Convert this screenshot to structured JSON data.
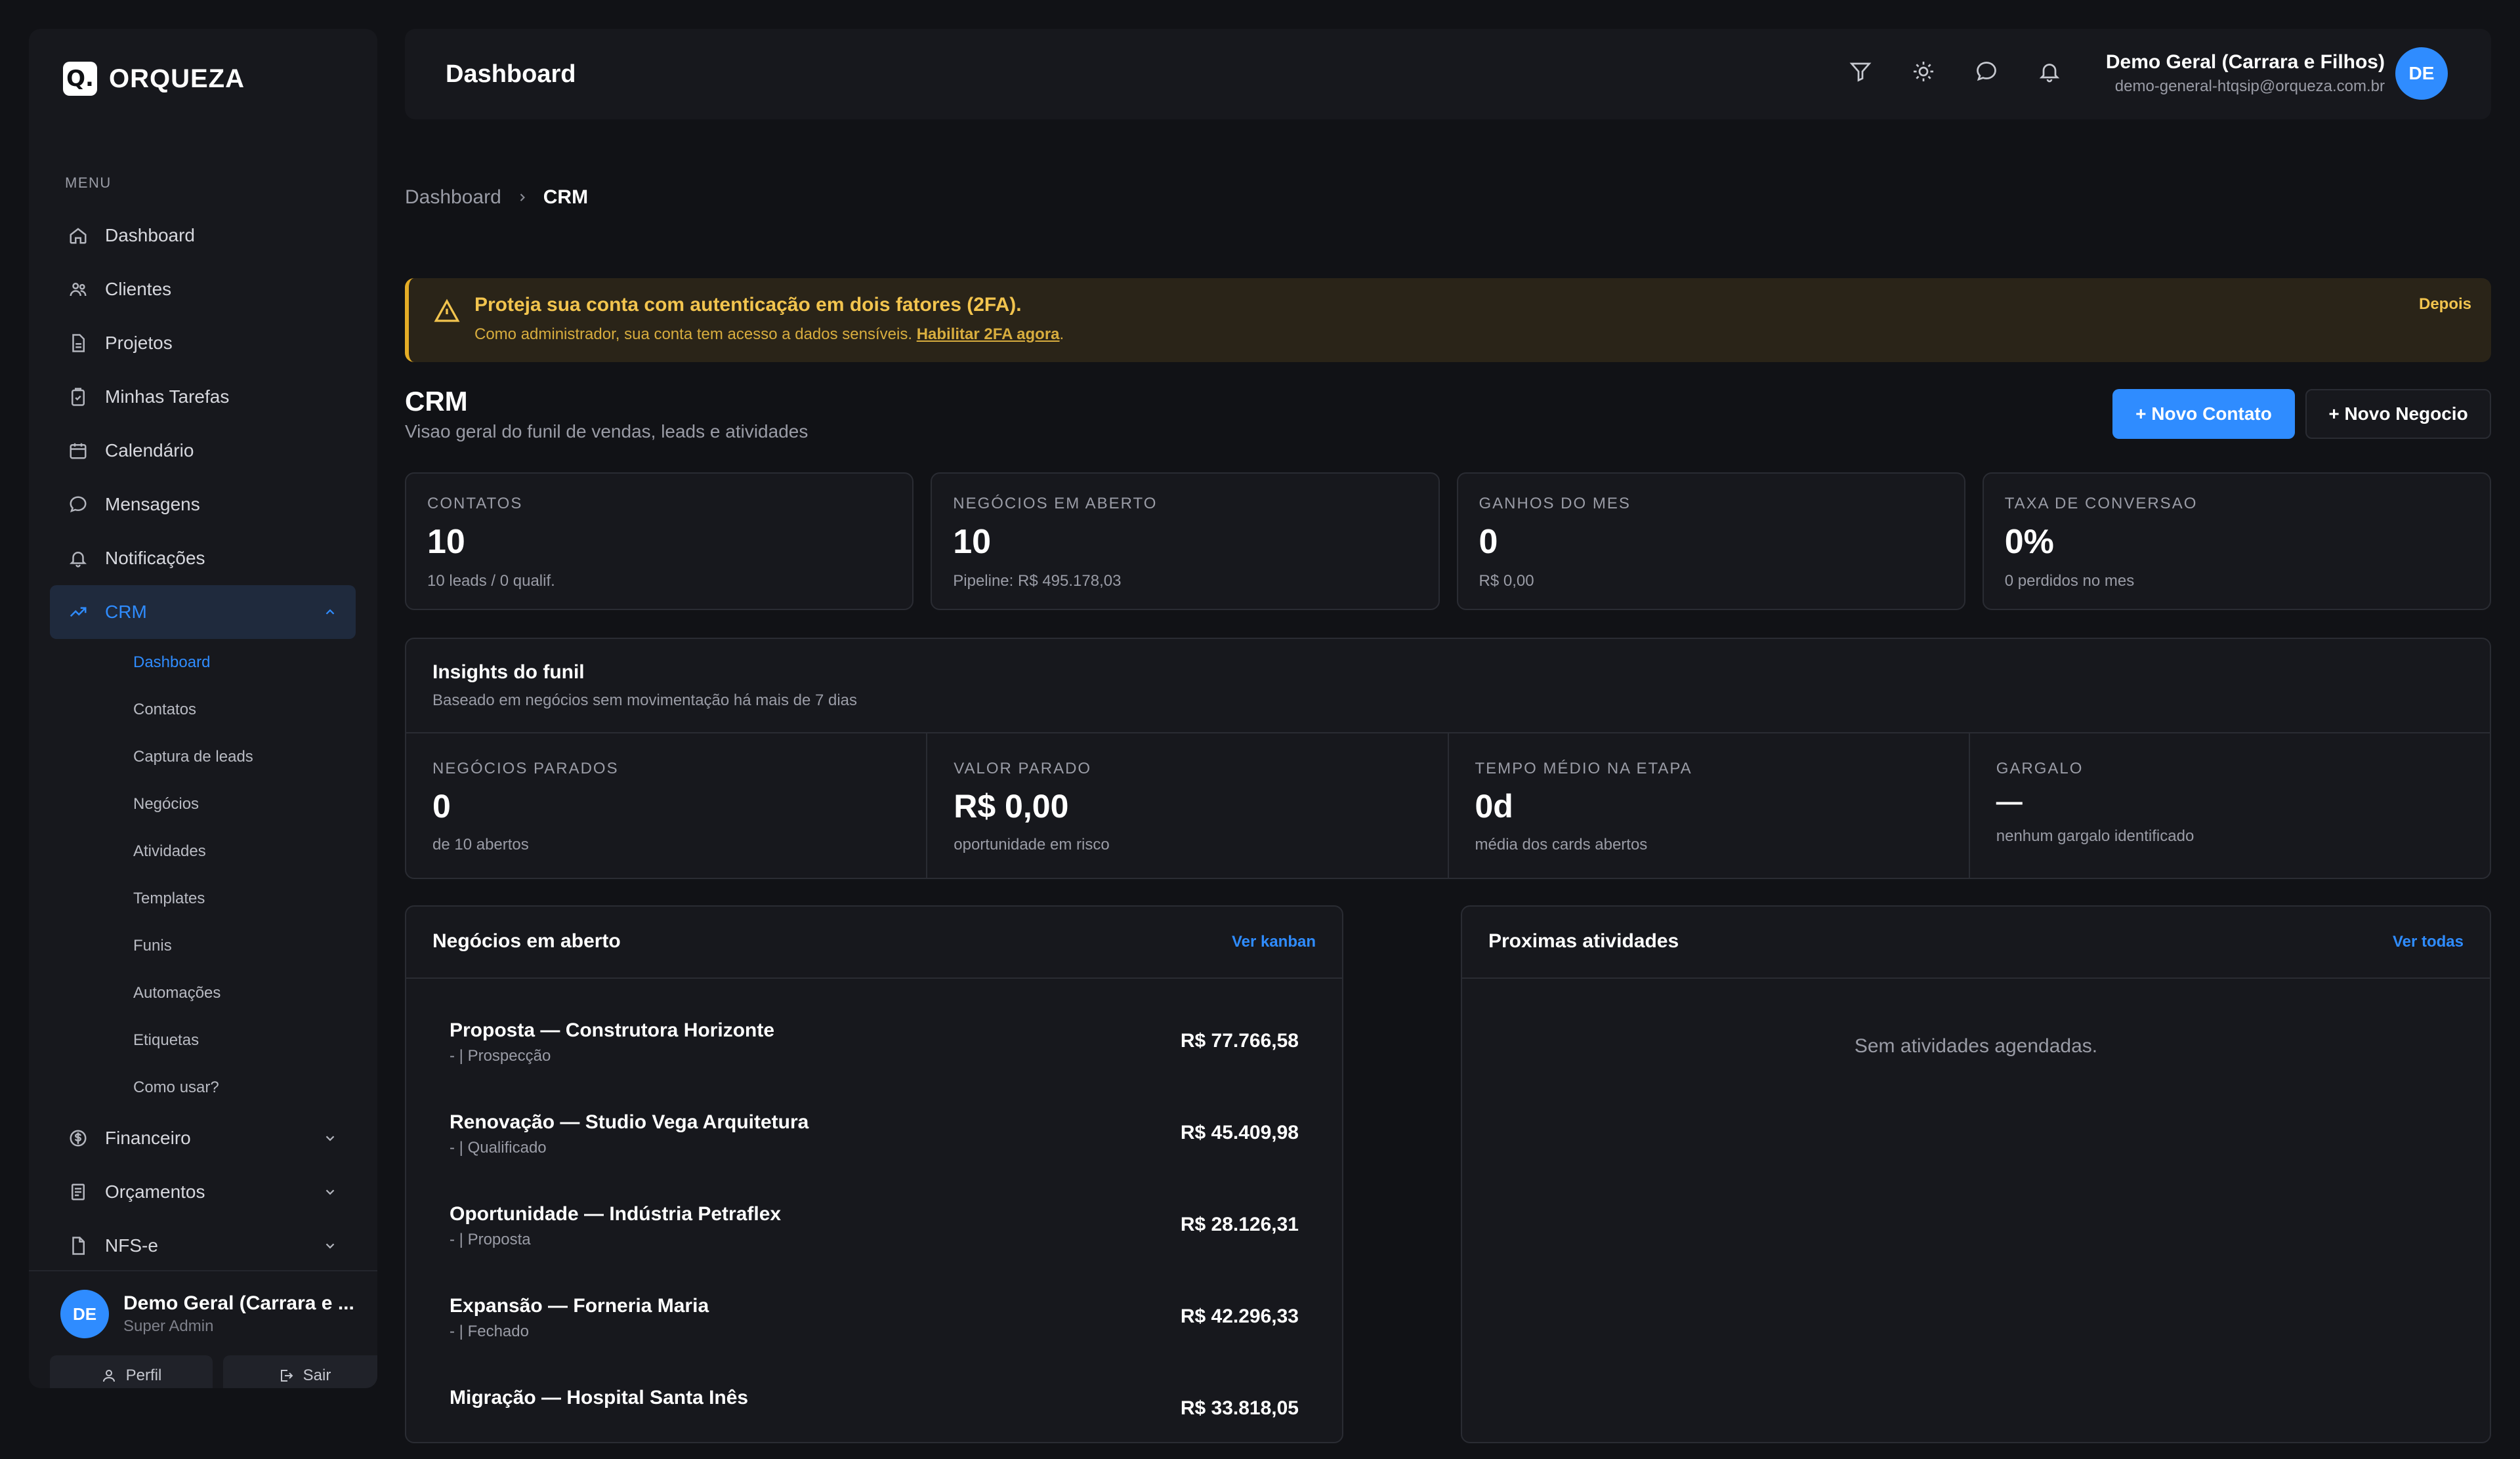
{
  "app": {
    "logo_mark": "Q.",
    "logo_text": "ORQUEZA"
  },
  "sidebar": {
    "menu_title": "MENU",
    "items": [
      {
        "label": "Dashboard",
        "icon": "home-icon"
      },
      {
        "label": "Clientes",
        "icon": "users-icon"
      },
      {
        "label": "Projetos",
        "icon": "file-icon"
      },
      {
        "label": "Minhas Tarefas",
        "icon": "clipboard-icon"
      },
      {
        "label": "Calendário",
        "icon": "calendar-icon"
      },
      {
        "label": "Mensagens",
        "icon": "chat-icon"
      },
      {
        "label": "Notificações",
        "icon": "bell-icon"
      },
      {
        "label": "CRM",
        "icon": "trend-icon",
        "active": true
      }
    ],
    "crm_sub": [
      {
        "label": "Dashboard",
        "active": true
      },
      {
        "label": "Contatos"
      },
      {
        "label": "Captura de leads"
      },
      {
        "label": "Negócios"
      },
      {
        "label": "Atividades"
      },
      {
        "label": "Templates"
      },
      {
        "label": "Funis"
      },
      {
        "label": "Automações"
      },
      {
        "label": "Etiquetas"
      },
      {
        "label": "Como usar?"
      }
    ],
    "after_items": [
      {
        "label": "Financeiro",
        "icon": "dollar-icon"
      },
      {
        "label": "Orçamentos",
        "icon": "receipt-icon"
      },
      {
        "label": "NFS-e",
        "icon": "invoice-icon"
      }
    ],
    "user": {
      "initials": "DE",
      "name": "Demo Geral (Carrara e ...",
      "role": "Super Admin"
    },
    "profile_label": "Perfil",
    "logout_label": "Sair"
  },
  "header": {
    "title": "Dashboard",
    "user_name": "Demo Geral (Carrara e Filhos)",
    "user_email": "demo-general-htqsip@orqueza.com.br",
    "user_initials": "DE"
  },
  "breadcrumb": {
    "root": "Dashboard",
    "current": "CRM"
  },
  "alert": {
    "title": "Proteja sua conta com autenticação em dois fatores (2FA).",
    "description": "Como administrador, sua conta tem acesso a dados sensíveis.",
    "link": "Habilitar 2FA agora",
    "dismiss": "Depois"
  },
  "crm": {
    "title": "CRM",
    "subtitle": "Visao geral do funil de vendas, leads e atividades",
    "new_contact": "+ Novo Contato",
    "new_deal": "+ Novo Negocio"
  },
  "stats": [
    {
      "label": "CONTATOS",
      "value": "10",
      "sub": "10 leads / 0 qualif."
    },
    {
      "label": "NEGÓCIOS EM ABERTO",
      "value": "10",
      "sub": "Pipeline: R$ 495.178,03"
    },
    {
      "label": "GANHOS DO MES",
      "value": "0",
      "sub": "R$ 0,00"
    },
    {
      "label": "TAXA DE CONVERSAO",
      "value": "0%",
      "sub": "0 perdidos no mes"
    }
  ],
  "insights": {
    "title": "Insights do funil",
    "subtitle": "Baseado em negócios sem movimentação há mais de 7 dias",
    "items": [
      {
        "label": "NEGÓCIOS PARADOS",
        "value": "0",
        "sub": "de 10 abertos"
      },
      {
        "label": "VALOR PARADO",
        "value": "R$ 0,00",
        "sub": "oportunidade em risco"
      },
      {
        "label": "TEMPO MÉDIO NA ETAPA",
        "value": "0d",
        "sub": "média dos cards abertos"
      },
      {
        "label": "GARGALO",
        "value": "—",
        "sub": "nenhum gargalo identificado"
      }
    ]
  },
  "deals_panel": {
    "title": "Negócios em aberto",
    "link": "Ver kanban",
    "deals": [
      {
        "name": "Proposta — Construtora Horizonte",
        "stage": "- | Prospecção",
        "value": "R$ 77.766,58"
      },
      {
        "name": "Renovação — Studio Vega Arquitetura",
        "stage": "- | Qualificado",
        "value": "R$ 45.409,98"
      },
      {
        "name": "Oportunidade — Indústria Petraflex",
        "stage": "- | Proposta",
        "value": "R$ 28.126,31"
      },
      {
        "name": "Expansão — Forneria Maria",
        "stage": "- | Fechado",
        "value": "R$ 42.296,33"
      },
      {
        "name": "Migração — Hospital Santa Inês",
        "stage": "",
        "value": "R$ 33.818,05"
      }
    ]
  },
  "activities_panel": {
    "title": "Proximas atividades",
    "link": "Ver todas",
    "empty": "Sem atividades agendadas."
  }
}
